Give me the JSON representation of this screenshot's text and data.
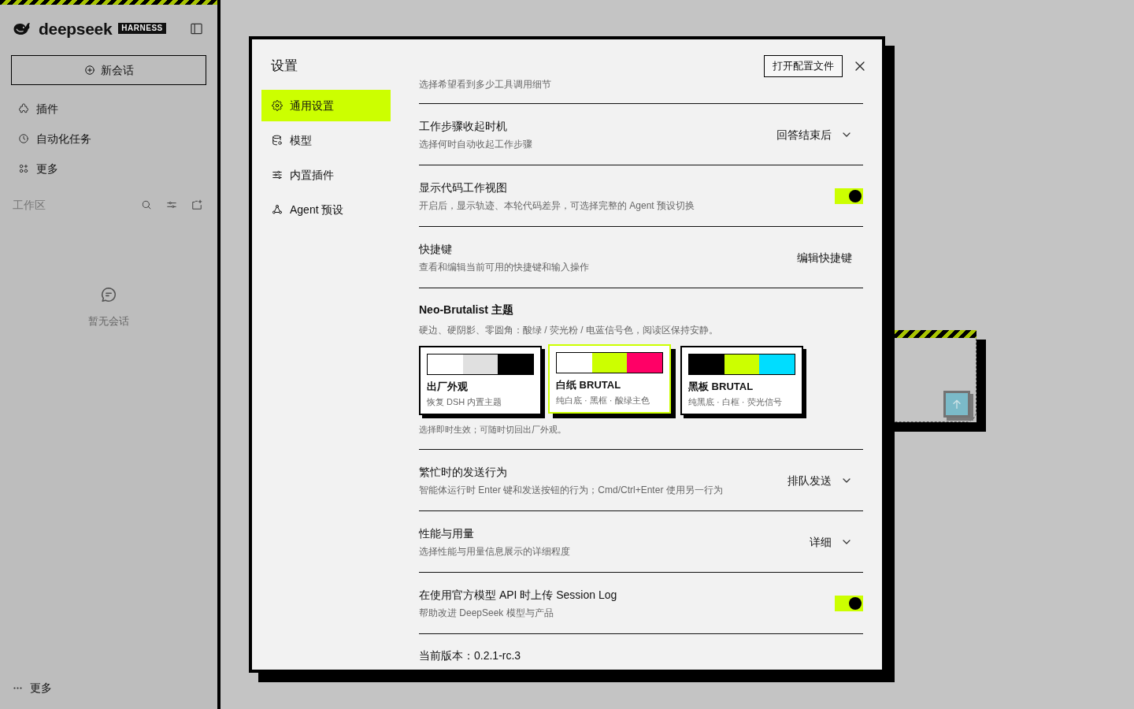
{
  "sidebar": {
    "logo": {
      "wordmark": "deepseek",
      "badge": "HARNESS"
    },
    "new_chat_button": "新会话",
    "nav_items": [
      {
        "label": "插件"
      },
      {
        "label": "自动化任务"
      },
      {
        "label": "更多"
      }
    ],
    "workspace": {
      "label": "工作区"
    },
    "empty_state": "暂无会话",
    "footer": {
      "label": "更多"
    }
  },
  "settings": {
    "title": "设置",
    "nav": [
      {
        "label": "通用设置",
        "selected": true
      },
      {
        "label": "模型",
        "selected": false
      },
      {
        "label": "内置插件",
        "selected": false
      },
      {
        "label": "Agent 预设",
        "selected": false
      }
    ],
    "open_config_button": "打开配置文件",
    "partial_description": "选择希望看到多少工具调用细节",
    "rows": [
      {
        "kind": "select",
        "title": "工作步骤收起时机",
        "description": "选择何时自动收起工作步骤",
        "value": "回答结束后"
      },
      {
        "kind": "toggle",
        "title": "显示代码工作视图",
        "description": "开启后，显示轨迹、本轮代码差异，可选择完整的 Agent 预设切换",
        "on": true
      },
      {
        "kind": "button",
        "title": "快捷键",
        "description": "查看和编辑当前可用的快捷键和输入操作",
        "button": "编辑快捷键"
      },
      {
        "kind": "theme",
        "title": "Neo-Brutalist 主题",
        "description": "硬边、硬阴影、零圆角：酸绿 / 荧光粉 / 电蓝信号色，阅读区保持安静。",
        "options": [
          {
            "name": "出厂外观",
            "description": "恢复 DSH 内置主题",
            "selected": false,
            "swatches": [
              {
                "color": "#ffffff"
              },
              {
                "color": "#e0e0e0"
              },
              {
                "color": "#000000"
              }
            ]
          },
          {
            "name": "白纸 BRUTAL",
            "description": "纯白底 · 黑框 · 酸绿主色",
            "selected": true,
            "swatches": [
              {
                "color": "#ffffff"
              },
              {
                "color": "#ccff00"
              },
              {
                "color": "#ff0066"
              }
            ]
          },
          {
            "name": "黑板 BRUTAL",
            "description": "纯黑底 · 白框 · 荧光信号",
            "selected": false,
            "swatches": [
              {
                "color": "#000000"
              },
              {
                "color": "#ccff00"
              },
              {
                "color": "#00ddff"
              }
            ]
          }
        ],
        "note": "选择即时生效；可随时切回出厂外观。"
      },
      {
        "kind": "select",
        "title": "繁忙时的发送行为",
        "description": "智能体运行时 Enter 键和发送按钮的行为；Cmd/Ctrl+Enter 使用另一行为",
        "value": "排队发送"
      },
      {
        "kind": "select",
        "title": "性能与用量",
        "description": "选择性能与用量信息展示的详细程度",
        "value": "详细"
      },
      {
        "kind": "toggle",
        "title": "在使用官方模型 API 时上传 Session Log",
        "description": "帮助改进 DeepSeek 模型与产品",
        "on": true
      }
    ],
    "version": "当前版本：0.2.1-rc.3"
  }
}
